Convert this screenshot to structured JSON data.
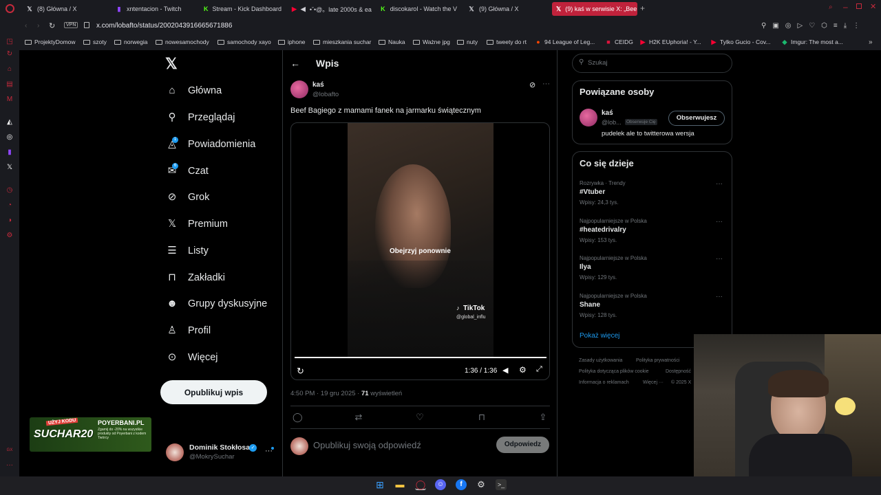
{
  "browser": {
    "tabs": [
      {
        "label": "(8) Główna / X",
        "icon": "x-logo-icon"
      },
      {
        "label": "xntentacion - Twitch",
        "icon": "twitch-icon"
      },
      {
        "label": "Stream - Kick Dashboard",
        "icon": "kick-icon"
      },
      {
        "label": "•ˇ•@。late 2000s & ea",
        "icon": "youtube-icon"
      },
      {
        "label": "discokarol - Watch the V",
        "icon": "kick-icon"
      },
      {
        "label": "(9) Główna / X",
        "icon": "x-logo-icon"
      },
      {
        "label": "(9) kaś w serwisie X: „Bee",
        "icon": "x-logo-icon",
        "active": true
      }
    ],
    "url": "x.com/lobafto/status/2002043916665671886",
    "vpn_label": "VPN",
    "bookmarks": [
      "ProjektyDomow",
      "szoty",
      "norwegia",
      "nowesamochody",
      "samochody xayo",
      "iphone",
      "mieszkania suchar",
      "Nauka",
      "Ważne jpg",
      "nuty",
      "tweety do rt",
      "94 League of Leg...",
      "CEIDG",
      "H2K EUphoria! - Y...",
      "Tylko Gucio - Cov...",
      "Imgur: The most a..."
    ]
  },
  "nav": {
    "items": [
      {
        "label": "Główna",
        "icon": "home-icon"
      },
      {
        "label": "Przeglądaj",
        "icon": "search-icon"
      },
      {
        "label": "Powiadomienia",
        "icon": "bell-icon",
        "badge": "1"
      },
      {
        "label": "Czat",
        "icon": "mail-icon",
        "badge": "6"
      },
      {
        "label": "Grok",
        "icon": "grok-icon"
      },
      {
        "label": "Premium",
        "icon": "x-logo-icon"
      },
      {
        "label": "Listy",
        "icon": "list-icon"
      },
      {
        "label": "Zakładki",
        "icon": "bookmark-icon"
      },
      {
        "label": "Grupy dyskusyjne",
        "icon": "people-icon"
      },
      {
        "label": "Profil",
        "icon": "person-icon"
      },
      {
        "label": "Więcej",
        "icon": "more-circle-icon"
      }
    ],
    "post_button": "Opublikuj wpis",
    "account": {
      "name": "Dominik Stokłosa",
      "handle": "@MokrySuchar"
    }
  },
  "post": {
    "header_title": "Wpis",
    "author_name": "kaś",
    "author_handle": "@lobafto",
    "text": "Beef Bagiego z mamami fanek na jarmarku świątecznym",
    "video_overlay": "Obejrzyj ponownie",
    "watermark_brand": "TikTok",
    "watermark_handle": "@global_influ",
    "time_display": "1:36 / 1:36",
    "progress": 1.0,
    "timestamp": "4:50 PM · 19 gru 2025 ·",
    "views_count": "71",
    "views_label": "wyświetleń",
    "reply_placeholder": "Opublikuj swoją odpowiedź",
    "reply_button": "Odpowiedz"
  },
  "sidebar": {
    "search_placeholder": "Szukaj",
    "related_title": "Powiązane osoby",
    "related_user": {
      "name": "kaś",
      "handle": "@lob...",
      "follows_you": "Obserwuje Cię",
      "bio": "pudelek ale to twitterowa wersja",
      "follow_button": "Obserwujesz"
    },
    "trends_title": "Co się dzieje",
    "trends": [
      {
        "meta": "Rozrywka · Trendy",
        "name": "#Vtuber",
        "posts": "Wpisy: 24,3 tys."
      },
      {
        "meta": "Najpopularniejsze w Polska",
        "name": "#heatedrivalry",
        "posts": "Wpisy: 153 tys."
      },
      {
        "meta": "Najpopularniejsze w Polska",
        "name": "Ilya",
        "posts": "Wpisy: 129 tys."
      },
      {
        "meta": "Najpopularniejsze w Polska",
        "name": "Shane",
        "posts": "Wpisy: 128 tys."
      }
    ],
    "show_more": "Pokaż więcej",
    "footer": [
      "Zasady użytkowania",
      "Polityka prywatności",
      "Polityka dotycząca plików cookie",
      "Dostępność",
      "Informacja o reklamach",
      "Więcej ···",
      "© 2025 X"
    ]
  },
  "ad": {
    "line1": "UŻYJ KODU",
    "code": "SUCHAR20",
    "brand": "POYERBANI.PL",
    "desc": "Zgarnij do -20% na wszystkie produkty od Poyerbani z kodem Twórcy"
  },
  "colors": {
    "accent": "#1d9bf0",
    "opera_red": "#c62a3c",
    "active_tab": "#c0223b"
  }
}
